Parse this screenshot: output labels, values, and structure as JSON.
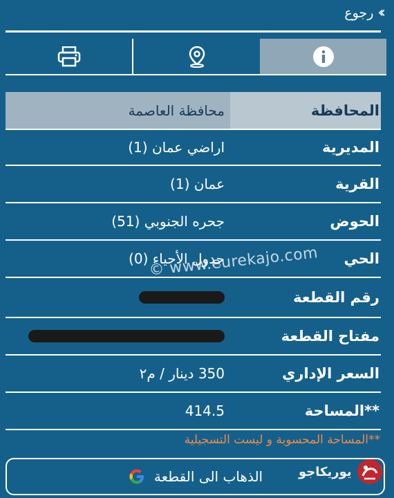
{
  "header": {
    "back_label": "رجوع"
  },
  "tabs": [
    {
      "name": "info",
      "active": true
    },
    {
      "name": "location",
      "active": false
    },
    {
      "name": "print",
      "active": false
    }
  ],
  "details": {
    "rows": [
      {
        "label": "المحافظة",
        "value": "محافظة العاصمة"
      },
      {
        "label": "المديرية",
        "value": "اراضي عمان (1)"
      },
      {
        "label": "القرية",
        "value": "عمان (1)"
      },
      {
        "label": "الحوض",
        "value": "جحره الجنوبي (51)"
      },
      {
        "label": "الحي",
        "value": "جدول الأحياء (0)"
      },
      {
        "label": "رقم القطعة",
        "value": ""
      },
      {
        "label": "مفتاح القطعة",
        "value": ""
      },
      {
        "label": "السعر الإداري",
        "value": "350 دينار / م٢"
      },
      {
        "label": "**المساحة",
        "value": "414.5"
      }
    ]
  },
  "watermark": "© www.eurekajo.com",
  "note": "**المساحة المحسوبة و ليست التسجيلية",
  "go_button": {
    "label": "الذهاب الى القطعة",
    "icon": "google-icon"
  },
  "logo": {
    "text": "يوريكاجو"
  },
  "colors": {
    "background": "#15608a",
    "active_tab": "#8fa7b6",
    "note": "#f08a4a"
  }
}
